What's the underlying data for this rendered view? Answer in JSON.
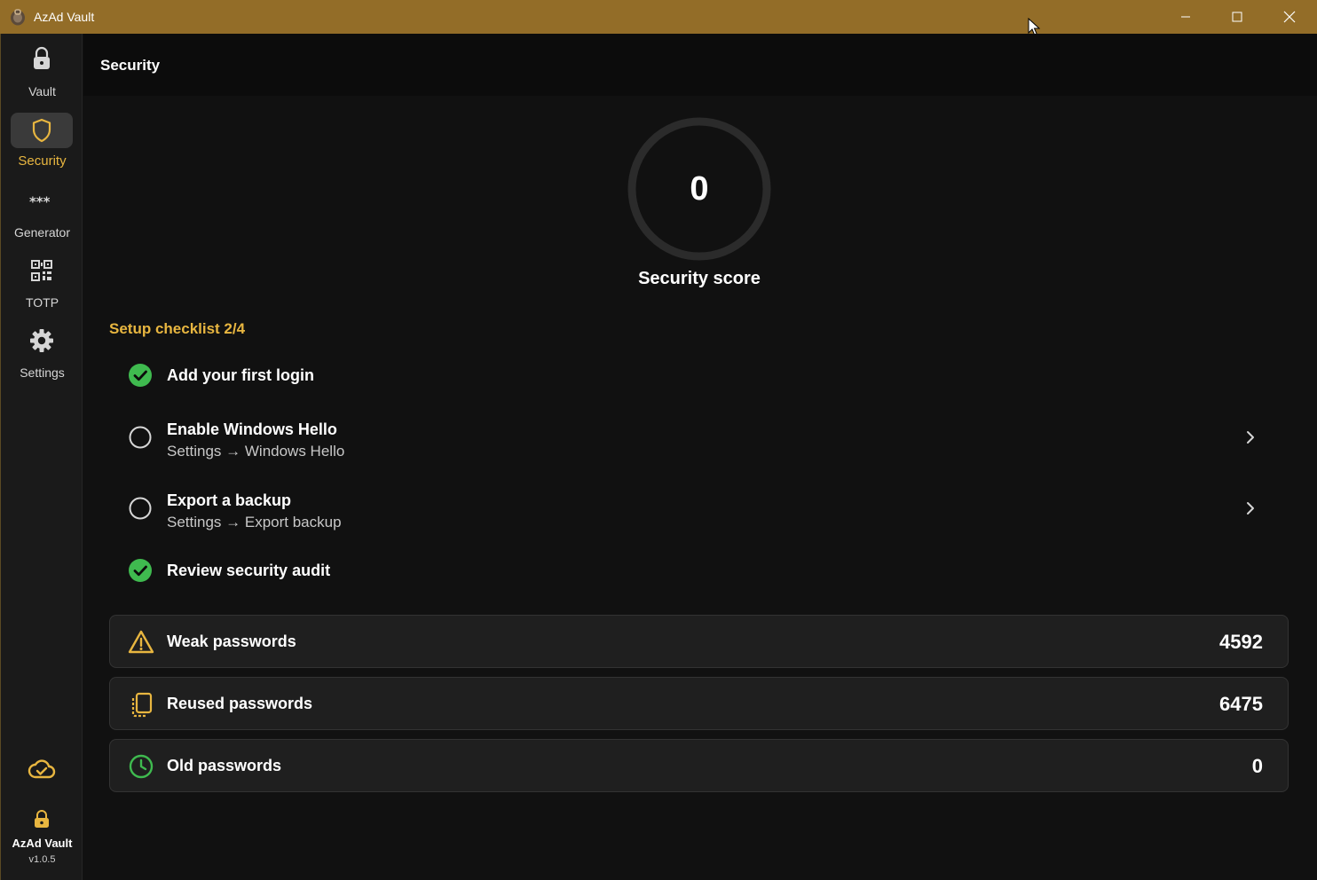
{
  "window": {
    "title": "AzAd Vault"
  },
  "sidebar": {
    "items": [
      {
        "label": "Vault",
        "icon": "lock-icon",
        "active": false
      },
      {
        "label": "Security",
        "icon": "shield-icon",
        "active": true
      },
      {
        "label": "Generator",
        "icon": "asterisks-icon",
        "active": false
      },
      {
        "label": "TOTP",
        "icon": "qr-code-icon",
        "active": false
      },
      {
        "label": "Settings",
        "icon": "gear-icon",
        "active": false
      }
    ],
    "sync_icon": "cloud-check-icon",
    "brand": {
      "name": "AzAd Vault",
      "version": "v1.0.5"
    }
  },
  "header": {
    "title": "Security"
  },
  "score": {
    "value": "0",
    "label": "Security score"
  },
  "checklist": {
    "title": "Setup checklist 2/4",
    "items": [
      {
        "title": "Add your first login",
        "subtitle": "",
        "done": true
      },
      {
        "title": "Enable Windows Hello",
        "subtitle": "Settings → Windows Hello",
        "done": false
      },
      {
        "title": "Export a backup",
        "subtitle": "Settings → Export backup",
        "done": false
      },
      {
        "title": "Review security audit",
        "subtitle": "",
        "done": true
      }
    ]
  },
  "stats": [
    {
      "label": "Weak passwords",
      "value": "4592",
      "icon": "warning-icon"
    },
    {
      "label": "Reused passwords",
      "value": "6475",
      "icon": "copy-icon"
    },
    {
      "label": "Old passwords",
      "value": "0",
      "icon": "clock-icon"
    }
  ],
  "colors": {
    "titlebar": "#936d28",
    "accent": "#e8b640",
    "success": "#3fba4f",
    "sidebar": "#1a1a1a",
    "card": "#1f1f1f"
  }
}
